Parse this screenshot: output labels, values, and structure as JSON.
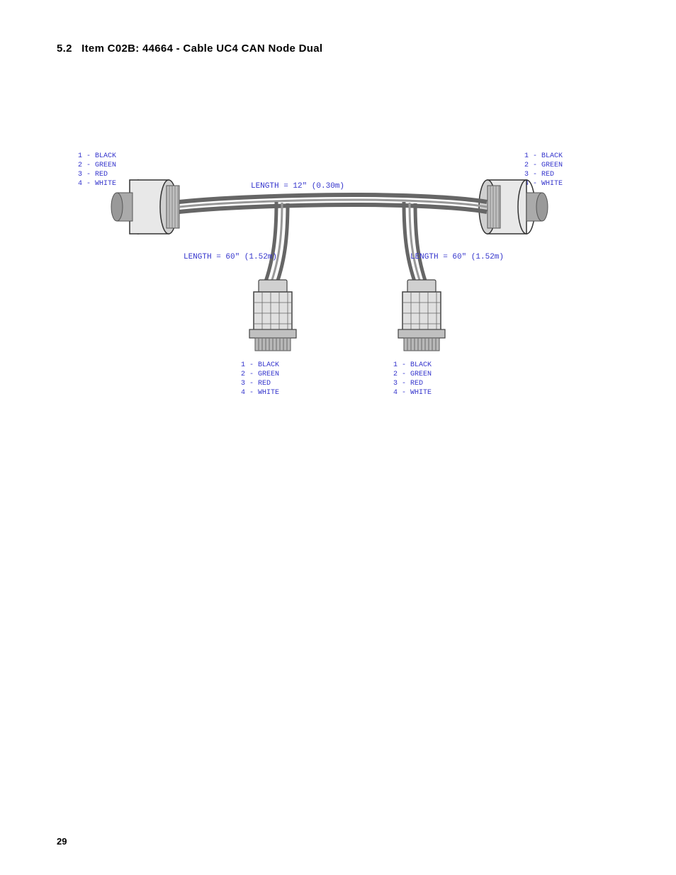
{
  "section": {
    "number": "5.2",
    "title": "Item C02B: 44664 - Cable UC4 CAN Node Dual"
  },
  "diagram": {
    "length_top": "LENGTH = 12\" (0.30m)",
    "length_left": "LENGTH = 60\" (1.52m)",
    "length_right": "LENGTH = 60\" (1.52m)",
    "connector_left_labels": [
      "1 - BLACK",
      "2 - GREEN",
      "3 - RED",
      "4 - WHITE"
    ],
    "connector_right_labels": [
      "1 - BLACK",
      "2 - GREEN",
      "3 - RED",
      "4 - WHITE"
    ],
    "connector_bottom_left_labels": [
      "1 - BLACK",
      "2 - GREEN",
      "3 - RED",
      "4 - WHITE"
    ],
    "connector_bottom_right_labels": [
      "1 - BLACK",
      "2 - GREEN",
      "3 - RED",
      "4 - WHITE"
    ]
  },
  "page_number": "29"
}
